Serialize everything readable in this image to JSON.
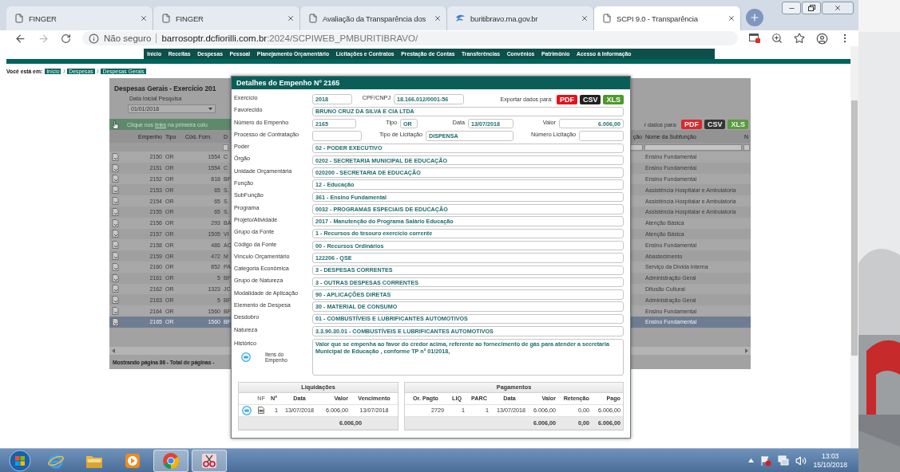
{
  "browser": {
    "tabs": [
      {
        "title": "FINGER",
        "kind": "page",
        "selected": false
      },
      {
        "title": "FINGER",
        "kind": "page",
        "selected": false
      },
      {
        "title": "Avaliação da Transparência dos",
        "kind": "page",
        "selected": false
      },
      {
        "title": "buritibravo.ma.gov.br",
        "kind": "site",
        "selected": false
      },
      {
        "title": "SCPI 9.0 - Transparência",
        "kind": "page",
        "selected": true
      }
    ],
    "security": "Não seguro",
    "host": "barrosoptr.dcfiorilli.com.br",
    "path": ":2024/SCPIWEB_PMBURITIBRAVO/"
  },
  "nav": [
    "Início",
    "Receitas",
    "Despesas",
    "Pessoal",
    "Planejamento Orçamentário",
    "Licitações e Contratos",
    "Prestação de Contas",
    "Transferências",
    "Convênios",
    "Patrimônio",
    "Acesso à Informação"
  ],
  "breadcrumb": [
    {
      "kind": "label",
      "text": "Você está em:"
    },
    {
      "kind": "link",
      "text": "Início"
    },
    {
      "kind": "sep",
      "text": "/"
    },
    {
      "kind": "link",
      "text": "Despesas"
    },
    {
      "kind": "sep",
      "text": "/"
    },
    {
      "kind": "link",
      "text": "Despesas Gerais"
    }
  ],
  "listing": {
    "title": "Despesas Gerais - Exercício 201",
    "date_label": "Data Inicial Pesquisa",
    "date_value": "01/01/2018",
    "hint": "Clique nos **links** na primeira colu",
    "export_label": "r dados para:",
    "exports": [
      {
        "label": "PDF",
        "kind": "pdf"
      },
      {
        "label": "CSV",
        "kind": "csv"
      },
      {
        "label": "XLS",
        "kind": "xls"
      }
    ],
    "columns_left": [
      "Empenho",
      "Tipo",
      "Cód. Forn.",
      "D"
    ],
    "columns_right": [
      "ção",
      "Nome da Subfunção",
      "N"
    ],
    "rows": [
      {
        "empenho": "2150",
        "tipo": "OR",
        "cod_forn": "1554",
        "column_4": "C",
        "subfuncao": "Ensino Fundamental",
        "selected": false
      },
      {
        "empenho": "2151",
        "tipo": "OR",
        "cod_forn": "1554",
        "column_4": "C",
        "subfuncao": "Ensino Fundamental",
        "selected": false
      },
      {
        "empenho": "2152",
        "tipo": "OR",
        "cod_forn": "818",
        "column_4": "BF",
        "subfuncao": "Ensino Fundamental",
        "selected": false
      },
      {
        "empenho": "2153",
        "tipo": "OR",
        "cod_forn": "65",
        "column_4": "S.",
        "subfuncao": "Assistência Hospitalar e Ambulatoria",
        "selected": false
      },
      {
        "empenho": "2154",
        "tipo": "OR",
        "cod_forn": "65",
        "column_4": "S.",
        "subfuncao": "Assistência Hospitalar e Ambulatoria",
        "selected": false
      },
      {
        "empenho": "2155",
        "tipo": "OR",
        "cod_forn": "65",
        "column_4": "S.",
        "subfuncao": "Assistência Hospitalar e Ambulatoria",
        "selected": false
      },
      {
        "empenho": "2156",
        "tipo": "OR",
        "cod_forn": "293",
        "column_4": "BA",
        "subfuncao": "Atenção Básica",
        "selected": false
      },
      {
        "empenho": "2157",
        "tipo": "OR",
        "cod_forn": "1505",
        "column_4": "VI",
        "subfuncao": "Atenção Básica",
        "selected": false
      },
      {
        "empenho": "2158",
        "tipo": "OR",
        "cod_forn": "486",
        "column_4": "AC",
        "subfuncao": "Ensino Fundamental",
        "selected": false
      },
      {
        "empenho": "2159",
        "tipo": "OR",
        "cod_forn": "472",
        "column_4": "M",
        "subfuncao": "Abastecimento",
        "selected": false
      },
      {
        "empenho": "2160",
        "tipo": "OR",
        "cod_forn": "852",
        "column_4": "PA",
        "subfuncao": "Serviço da Dívida Interna",
        "selected": false
      },
      {
        "empenho": "2161",
        "tipo": "OR",
        "cod_forn": "5",
        "column_4": "BF",
        "subfuncao": "Administração Geral",
        "selected": false
      },
      {
        "empenho": "2162",
        "tipo": "OR",
        "cod_forn": "1323",
        "column_4": "JC",
        "subfuncao": "Difusão Cultural",
        "selected": false
      },
      {
        "empenho": "2163",
        "tipo": "OR",
        "cod_forn": "5",
        "column_4": "BF",
        "subfuncao": "Administração Geral",
        "selected": false
      },
      {
        "empenho": "2164",
        "tipo": "OR",
        "cod_forn": "1560",
        "column_4": "BF",
        "subfuncao": "Ensino Fundamental",
        "selected": false
      },
      {
        "empenho": "2165",
        "tipo": "OR",
        "cod_forn": "1560",
        "column_4": "BF",
        "subfuncao": "Ensino Fundamental",
        "selected": true
      }
    ],
    "pager": "Mostrando página 86 - Total de páginas -"
  },
  "modal": {
    "title": "Detalhes do Empenho Nº 2165",
    "export_label": "Exportar dados para:",
    "exports": [
      {
        "label": "PDF",
        "kind": "pdf"
      },
      {
        "label": "CSV",
        "kind": "csv"
      },
      {
        "label": "XLS",
        "kind": "xls"
      }
    ],
    "lines": [
      {
        "kind": "top",
        "fields": [
          {
            "label": "Exercício",
            "value": "2018"
          },
          {
            "label": "CPF/CNPJ",
            "value": "18.166.012/0001-56"
          }
        ]
      },
      {
        "kind": "wide",
        "fields": [
          {
            "label": "Favorecido",
            "value": "BRUNO CRUZ DA SILVA E CIA LTDA"
          }
        ]
      },
      {
        "kind": "quad",
        "fields": [
          {
            "label": "Número do Empenho",
            "value": "2165"
          },
          {
            "label": "Tipo",
            "value": "OR"
          },
          {
            "label": "Data",
            "value": "13/07/2018"
          },
          {
            "label": "Valor",
            "value": "6.006,00"
          }
        ]
      },
      {
        "kind": "triple",
        "fields": [
          {
            "label": "Processo de Contratação"
          },
          {
            "label": "Tipo de Licitação",
            "value": "DISPENSA"
          },
          {
            "label": "Número Licitação"
          }
        ]
      },
      {
        "kind": "wide",
        "fields": [
          {
            "label": "Poder",
            "value": "02 - PODER EXECUTIVO"
          }
        ]
      },
      {
        "kind": "wide",
        "fields": [
          {
            "label": "Órgão",
            "value": "0202 - SECRETARIA MUNICIPAL DE EDUCAÇÃO"
          }
        ]
      },
      {
        "kind": "wide",
        "fields": [
          {
            "label": "Unidade Orçamentária",
            "value": "020200 - SECRETARIA DE EDUCAÇÃO"
          }
        ]
      },
      {
        "kind": "wide",
        "fields": [
          {
            "label": "Função",
            "value": "12 - Educação"
          }
        ]
      },
      {
        "kind": "wide",
        "fields": [
          {
            "label": "SubFunção",
            "value": "361 - Ensino Fundamental"
          }
        ]
      },
      {
        "kind": "wide",
        "fields": [
          {
            "label": "Programa",
            "value": "0032 - PROGRAMAS ESPECIAIS DE EDUCAÇÃO"
          }
        ]
      },
      {
        "kind": "wide",
        "fields": [
          {
            "label": "Projeto/Atividade",
            "value": "2017 - Manutenção do Programa Salário Educação"
          }
        ]
      },
      {
        "kind": "wide",
        "fields": [
          {
            "label": "Grupo da Fonte",
            "value": "1 - Recursos do tesouro exercício corrente"
          }
        ]
      },
      {
        "kind": "wide",
        "fields": [
          {
            "label": "Código da Fonte",
            "value": "00 - Recursos Ordinários"
          }
        ]
      },
      {
        "kind": "wide",
        "fields": [
          {
            "label": "Vínculo Orçamentário",
            "value": "122206 - QSE"
          }
        ]
      },
      {
        "kind": "wide",
        "fields": [
          {
            "label": "Categoria Econômica",
            "value": "3 - DESPESAS CORRENTES"
          }
        ]
      },
      {
        "kind": "wide",
        "fields": [
          {
            "label": "Grupo de Natureza",
            "value": "3 - OUTRAS DESPESAS CORRENTES"
          }
        ]
      },
      {
        "kind": "wide",
        "fields": [
          {
            "label": "Modalidade de Aplicação",
            "value": "90 - APLICAÇÕES DIRETAS"
          }
        ]
      },
      {
        "kind": "wide",
        "fields": [
          {
            "label": "Elemento de Despesa",
            "value": "30 - MATERIAL DE CONSUMO"
          }
        ]
      },
      {
        "kind": "wide",
        "fields": [
          {
            "label": "Desdobro",
            "value": "01 - COMBUSTÍVEIS E LUBRIFICANTES AUTOMOTIVOS"
          }
        ]
      },
      {
        "kind": "wide",
        "fields": [
          {
            "label": "Natureza",
            "value": "3.3.90.30.01 - COMBUSTÍVEIS E LUBRIFICANTES AUTOMOTIVOS"
          }
        ]
      }
    ],
    "history": {
      "label": "Histórico",
      "value": "Valor que se empenha ao favor do credor acima, referente ao fornecimento de gás para atender a secretaria Municipal de Educação , conforme TP nº 01/2018,",
      "items_label": "Itens do Empenho"
    },
    "liquidacoes": {
      "title": "Liquidações",
      "columns": [
        {
          "kind": "blank"
        },
        {
          "kind": "text",
          "label": "NF"
        },
        {
          "kind": "text",
          "label": "Nº"
        },
        {
          "kind": "text",
          "label": "Data"
        },
        {
          "kind": "text",
          "label": "Valor"
        },
        {
          "kind": "text",
          "label": "Vencimento"
        }
      ],
      "rows": [
        {
          "cells": [
            {
              "kind": "items"
            },
            {
              "kind": "nf"
            },
            {
              "kind": "text",
              "text": "1"
            },
            {
              "kind": "text",
              "text": "13/07/2018"
            },
            {
              "kind": "text",
              "text": "6.006,00"
            },
            {
              "kind": "text",
              "text": "13/07/2018"
            }
          ]
        }
      ],
      "total": "6.006,00"
    },
    "pagamentos": {
      "title": "Pagamentos",
      "columns": [
        "Or. Pagto",
        "LIQ",
        "PARC",
        "Data",
        "Valor",
        "Retenção",
        "Pago"
      ],
      "rows": [
        {
          "cells": [
            "2729",
            "1",
            "1",
            "13/07/2018",
            "6.006,00",
            "0,00",
            "6.006,00"
          ]
        }
      ],
      "totals": [
        "6.006,00",
        "0,00",
        "6.006,00"
      ]
    }
  },
  "taskbar": {
    "apps": [
      {
        "kind": "ie",
        "active": false
      },
      {
        "kind": "explorer",
        "active": false
      },
      {
        "kind": "media",
        "active": false
      },
      {
        "kind": "chrome",
        "active": true
      },
      {
        "kind": "snipping",
        "active": true
      }
    ],
    "time": "13:03",
    "date": "15/10/2018"
  }
}
